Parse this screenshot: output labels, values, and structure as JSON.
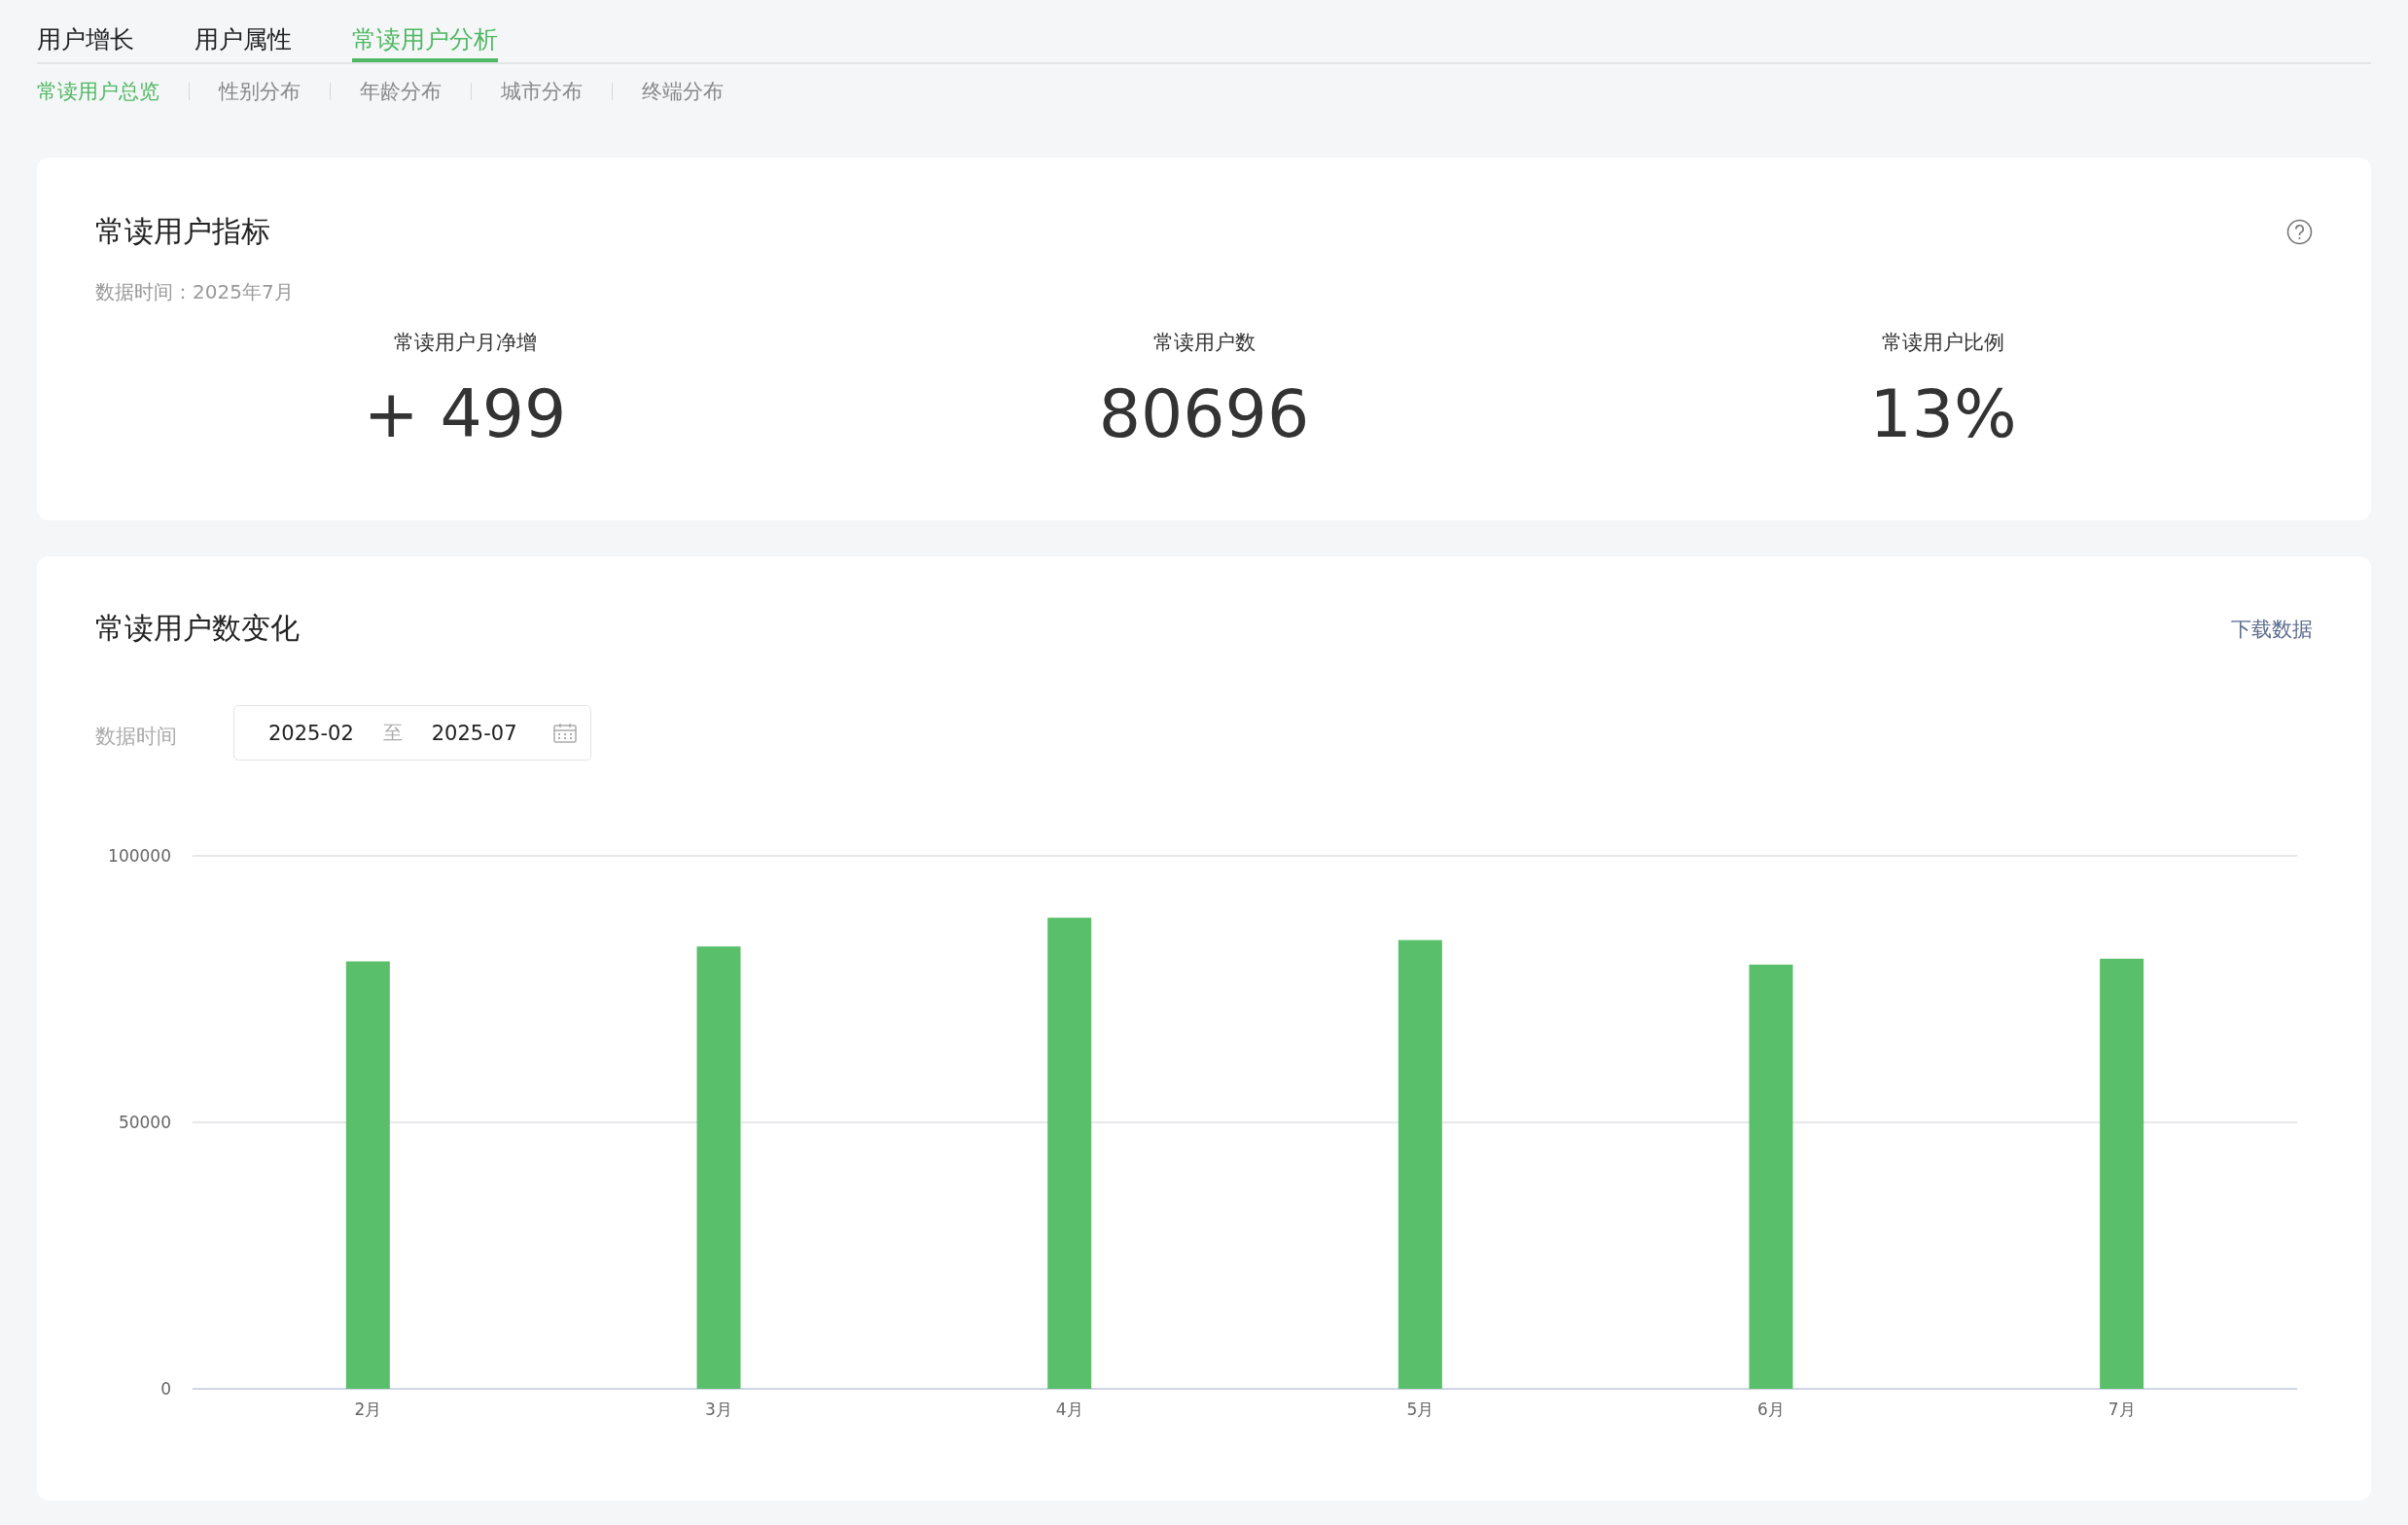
{
  "top_tabs": [
    {
      "label": "用户增长",
      "selected": false
    },
    {
      "label": "用户属性",
      "selected": false
    },
    {
      "label": "常读用户分析",
      "selected": true
    }
  ],
  "sub_tabs": [
    {
      "label": "常读用户总览",
      "selected": true
    },
    {
      "label": "性别分布",
      "selected": false
    },
    {
      "label": "年龄分布",
      "selected": false
    },
    {
      "label": "城市分布",
      "selected": false
    },
    {
      "label": "终端分布",
      "selected": false
    }
  ],
  "metrics_card": {
    "title": "常读用户指标",
    "data_time": "数据时间：2025年7月",
    "metrics": [
      {
        "label": "常读用户月净增",
        "value": "+ 499"
      },
      {
        "label": "常读用户数",
        "value": "80696"
      },
      {
        "label": "常读用户比例",
        "value": "13%"
      }
    ]
  },
  "trend_card": {
    "title": "常读用户数变化",
    "download_link": "下载数据",
    "date_label": "数据时间",
    "date_start": "2025-02",
    "date_separator": "至",
    "date_end": "2025-07",
    "chart_data": {
      "type": "bar",
      "categories": [
        "2月",
        "3月",
        "4月",
        "5月",
        "6月",
        "7月"
      ],
      "series": [
        {
          "color": "#5abf6a",
          "values": [
            80200,
            83000,
            88400,
            84200,
            79600,
            80700
          ]
        }
      ],
      "ylim": [
        0,
        100000
      ],
      "yticks": [
        0,
        50000,
        100000
      ]
    }
  }
}
